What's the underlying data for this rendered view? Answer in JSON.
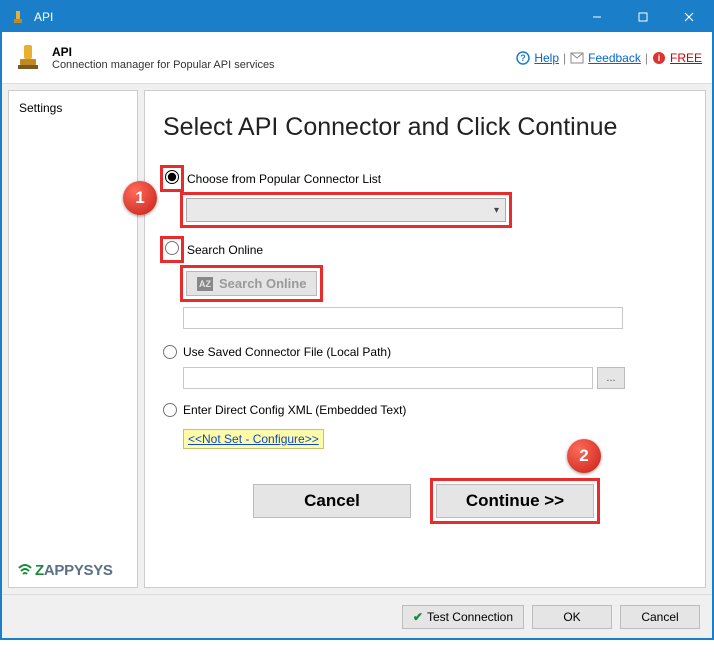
{
  "window": {
    "title": "API"
  },
  "header": {
    "title": "API",
    "subtitle": "Connection manager for Popular API services",
    "links": {
      "help": "Help",
      "feedback": "Feedback",
      "free": "FREE"
    }
  },
  "sidebar": {
    "items": [
      "Settings"
    ],
    "brand": {
      "prefix": "Z",
      "rest": "APPYSYS"
    }
  },
  "main": {
    "title": "Select API Connector and Click Continue",
    "options": {
      "popular": {
        "label": "Choose from Popular Connector List",
        "selected": true,
        "dropdown_value": ""
      },
      "search": {
        "label": "Search Online",
        "selected": false,
        "button_label": "Search Online",
        "input_value": ""
      },
      "saved": {
        "label": "Use Saved Connector File (Local Path)",
        "selected": false,
        "path_value": "",
        "browse_label": "..."
      },
      "xml": {
        "label": "Enter Direct Config XML (Embedded Text)",
        "selected": false,
        "link_text": "<<Not Set - Configure>>"
      }
    },
    "actions": {
      "cancel": "Cancel",
      "continue": "Continue >>"
    },
    "steps": {
      "one": "1",
      "two": "2"
    }
  },
  "footer": {
    "test": "Test Connection",
    "ok": "OK",
    "cancel": "Cancel"
  }
}
